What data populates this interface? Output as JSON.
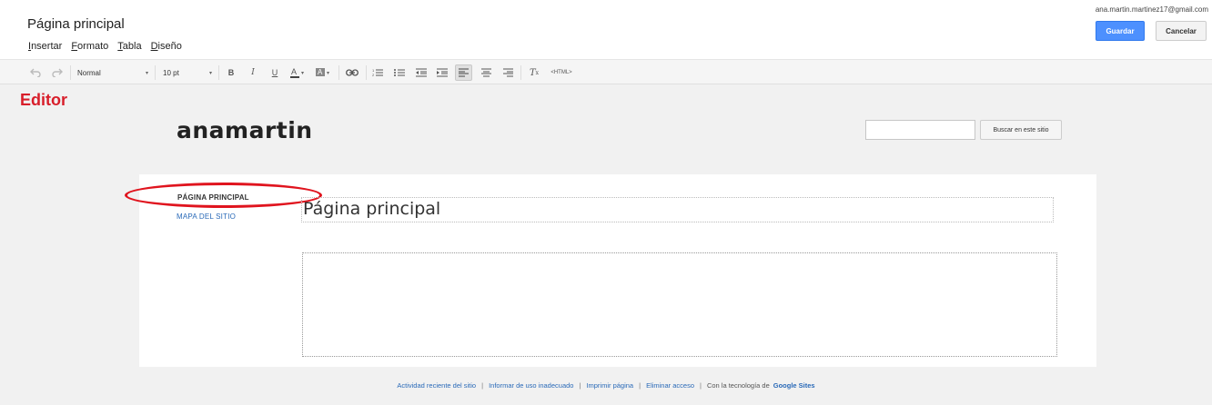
{
  "header": {
    "doc_title": "Página principal",
    "menu": [
      "Insertar",
      "Formato",
      "Tabla",
      "Diseño"
    ],
    "account": "ana.martin.martinez17@gmail.com",
    "save_label": "Guardar",
    "cancel_label": "Cancelar"
  },
  "toolbar": {
    "style_select": "Normal",
    "size_select": "10 pt",
    "html_label": "<HTML>"
  },
  "annotation": {
    "editor_label": "Editor",
    "highlight_color": "#e0141e"
  },
  "site": {
    "name": "anamartin",
    "search_button": "Buscar en este sitio",
    "search_value": ""
  },
  "sidebar": {
    "items": [
      {
        "label": "PÁGINA PRINCIPAL",
        "active": true
      },
      {
        "label": "MAPA DEL SITIO",
        "active": false
      }
    ]
  },
  "main": {
    "page_title": "Página principal"
  },
  "footer": {
    "links": [
      "Actividad reciente del sitio",
      "Informar de uso inadecuado",
      "Imprimir página",
      "Eliminar acceso"
    ],
    "powered_prefix": "Con la tecnología de",
    "powered_brand": "Google Sites"
  },
  "colors": {
    "accent": "#4d90fe",
    "link": "#2a6ab8",
    "annotation": "#d81e2a"
  }
}
